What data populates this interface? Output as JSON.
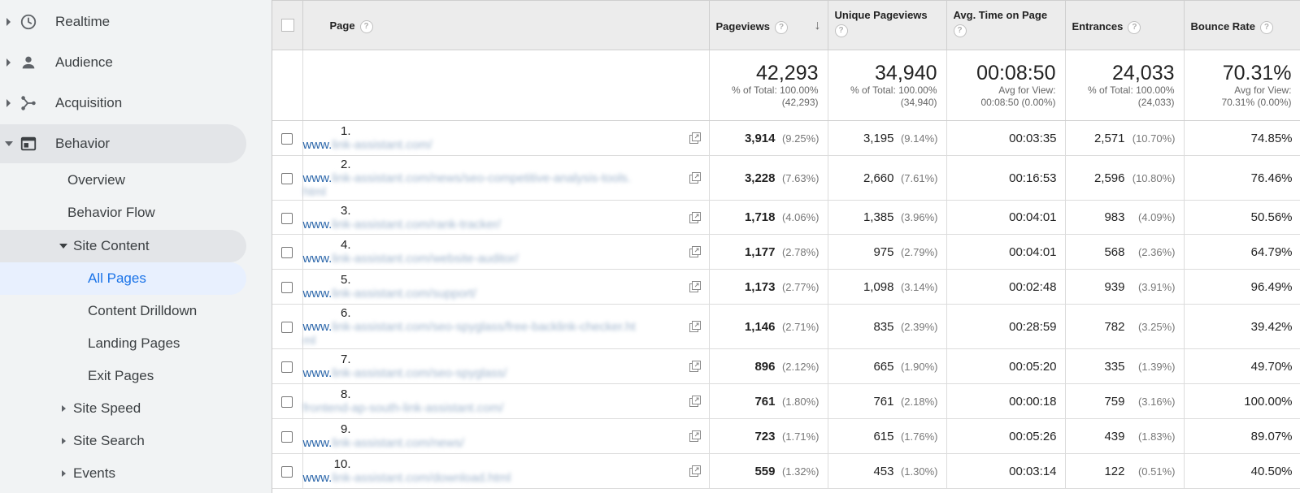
{
  "sidebar": {
    "top_items": [
      {
        "label": "Realtime",
        "icon": "clock-icon"
      },
      {
        "label": "Audience",
        "icon": "person-icon"
      },
      {
        "label": "Acquisition",
        "icon": "acquisition-icon"
      },
      {
        "label": "Behavior",
        "icon": "behavior-icon"
      }
    ],
    "behavior_items": {
      "overview": "Overview",
      "behavior_flow": "Behavior Flow",
      "site_content": "Site Content",
      "all_pages": "All Pages",
      "content_drilldown": "Content Drilldown",
      "landing_pages": "Landing Pages",
      "exit_pages": "Exit Pages",
      "site_speed": "Site Speed",
      "site_search": "Site Search",
      "events": "Events"
    }
  },
  "table": {
    "headers": {
      "page": "Page",
      "pageviews": "Pageviews",
      "unique_pageviews": "Unique Pageviews",
      "avg_time": "Avg. Time on Page",
      "entrances": "Entrances",
      "bounce_rate": "Bounce Rate"
    },
    "totals": {
      "pageviews": {
        "value": "42,293",
        "line1": "% of Total: 100.00%",
        "line2": "(42,293)"
      },
      "unique_pageviews": {
        "value": "34,940",
        "line1": "% of Total: 100.00%",
        "line2": "(34,940)"
      },
      "avg_time": {
        "value": "00:08:50",
        "line1": "Avg for View:",
        "line2": "00:08:50 (0.00%)"
      },
      "entrances": {
        "value": "24,033",
        "line1": "% of Total: 100.00%",
        "line2": "(24,033)"
      },
      "bounce_rate": {
        "value": "70.31%",
        "line1": "Avg for View:",
        "line2": "70.31% (0.00%)"
      }
    },
    "rows": [
      {
        "idx": "1.",
        "url_prefix": "www.",
        "url_rest": "link-assistant.com/",
        "pv": "3,914",
        "pv_pct": "(9.25%)",
        "upv": "3,195",
        "upv_pct": "(9.14%)",
        "time": "00:03:35",
        "ent": "2,571",
        "ent_pct": "(10.70%)",
        "bounce": "74.85%"
      },
      {
        "idx": "2.",
        "url_prefix": "www.",
        "url_rest": "link-assistant.com/news/seo-competitive-analysis-tools.html",
        "pv": "3,228",
        "pv_pct": "(7.63%)",
        "upv": "2,660",
        "upv_pct": "(7.61%)",
        "time": "00:16:53",
        "ent": "2,596",
        "ent_pct": "(10.80%)",
        "bounce": "76.46%"
      },
      {
        "idx": "3.",
        "url_prefix": "www.",
        "url_rest": "link-assistant.com/rank-tracker/",
        "pv": "1,718",
        "pv_pct": "(4.06%)",
        "upv": "1,385",
        "upv_pct": "(3.96%)",
        "time": "00:04:01",
        "ent": "983",
        "ent_pct": "(4.09%)",
        "bounce": "50.56%"
      },
      {
        "idx": "4.",
        "url_prefix": "www.",
        "url_rest": "link-assistant.com/website-auditor/",
        "pv": "1,177",
        "pv_pct": "(2.78%)",
        "upv": "975",
        "upv_pct": "(2.79%)",
        "time": "00:04:01",
        "ent": "568",
        "ent_pct": "(2.36%)",
        "bounce": "64.79%"
      },
      {
        "idx": "5.",
        "url_prefix": "www.",
        "url_rest": "link-assistant.com/support/",
        "pv": "1,173",
        "pv_pct": "(2.77%)",
        "upv": "1,098",
        "upv_pct": "(3.14%)",
        "time": "00:02:48",
        "ent": "939",
        "ent_pct": "(3.91%)",
        "bounce": "96.49%"
      },
      {
        "idx": "6.",
        "url_prefix": "www.",
        "url_rest": "link-assistant.com/seo-spyglass/free-backlink-checker.html",
        "pv": "1,146",
        "pv_pct": "(2.71%)",
        "upv": "835",
        "upv_pct": "(2.39%)",
        "time": "00:28:59",
        "ent": "782",
        "ent_pct": "(3.25%)",
        "bounce": "39.42%"
      },
      {
        "idx": "7.",
        "url_prefix": "www.",
        "url_rest": "link-assistant.com/seo-spyglass/",
        "pv": "896",
        "pv_pct": "(2.12%)",
        "upv": "665",
        "upv_pct": "(1.90%)",
        "time": "00:05:20",
        "ent": "335",
        "ent_pct": "(1.39%)",
        "bounce": "49.70%"
      },
      {
        "idx": "8.",
        "url_prefix": "",
        "url_rest": "frontend-ap-south-link-assistant.com/",
        "pv": "761",
        "pv_pct": "(1.80%)",
        "upv": "761",
        "upv_pct": "(2.18%)",
        "time": "00:00:18",
        "ent": "759",
        "ent_pct": "(3.16%)",
        "bounce": "100.00%"
      },
      {
        "idx": "9.",
        "url_prefix": "www.",
        "url_rest": "link-assistant.com/news/",
        "pv": "723",
        "pv_pct": "(1.71%)",
        "upv": "615",
        "upv_pct": "(1.76%)",
        "time": "00:05:26",
        "ent": "439",
        "ent_pct": "(1.83%)",
        "bounce": "89.07%"
      },
      {
        "idx": "10.",
        "url_prefix": "www.",
        "url_rest": "link-assistant.com/download.html",
        "pv": "559",
        "pv_pct": "(1.32%)",
        "upv": "453",
        "upv_pct": "(1.30%)",
        "time": "00:03:14",
        "ent": "122",
        "ent_pct": "(0.51%)",
        "bounce": "40.50%"
      }
    ]
  },
  "help_glyph": "?",
  "sort_glyph": "↓",
  "colors": {
    "link": "#2a65a9",
    "selected_nav": "#1a73e8",
    "sidebar_bg": "#f1f3f4"
  }
}
